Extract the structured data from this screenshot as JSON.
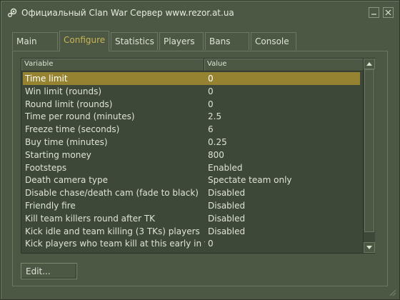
{
  "window": {
    "title": "Официальный Clan War Сервер www.rezor.at.ua"
  },
  "tabs": [
    {
      "label": "Main",
      "active": false
    },
    {
      "label": "Configure",
      "active": true
    },
    {
      "label": "Statistics",
      "active": false
    },
    {
      "label": "Players",
      "active": false
    },
    {
      "label": "Bans",
      "active": false
    },
    {
      "label": "Console",
      "active": false
    }
  ],
  "list": {
    "columns": [
      "Variable",
      "Value"
    ],
    "rows": [
      {
        "variable": "Time limit",
        "value": "0",
        "selected": true
      },
      {
        "variable": "Win limit (rounds)",
        "value": "0"
      },
      {
        "variable": "Round limit (rounds)",
        "value": "0"
      },
      {
        "variable": "Time per round (minutes)",
        "value": "2.5"
      },
      {
        "variable": "Freeze time (seconds)",
        "value": "6"
      },
      {
        "variable": "Buy time (minutes)",
        "value": "0.25"
      },
      {
        "variable": "Starting money",
        "value": "800"
      },
      {
        "variable": "Footsteps",
        "value": "Enabled"
      },
      {
        "variable": "Death camera type",
        "value": "Spectate team only"
      },
      {
        "variable": "Disable chase/death cam (fade to black)",
        "value": "Disabled"
      },
      {
        "variable": "Friendly fire",
        "value": "Disabled"
      },
      {
        "variable": "Kill team killers round after TK",
        "value": "Disabled"
      },
      {
        "variable": "Kick idle and team killing (3 TKs) players",
        "value": "Disabled"
      },
      {
        "variable": "Kick players who team kill at this early in t...",
        "value": "0"
      }
    ]
  },
  "buttons": {
    "edit_label": "Edit..."
  },
  "colors": {
    "background": "#4c5844",
    "selected_row": "#958331",
    "active_tab_text": "#c9b355"
  }
}
